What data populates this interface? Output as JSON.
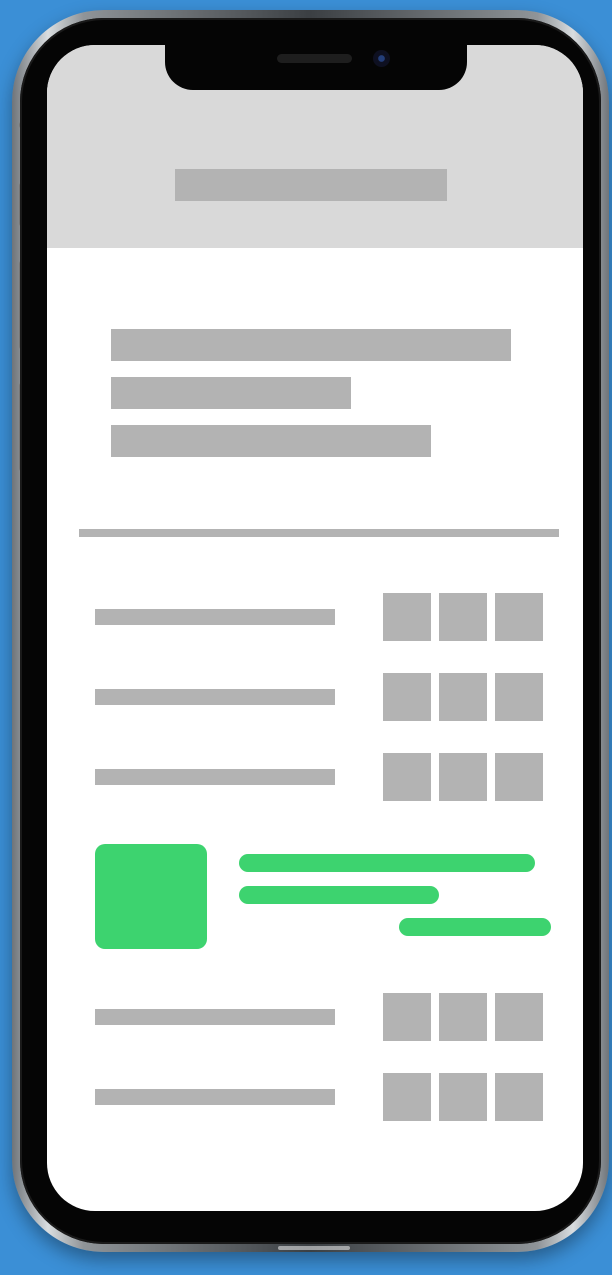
{
  "colors": {
    "background": "#3b8fd6",
    "header": "#d9d9d9",
    "placeholder": "#b3b3b3",
    "accent": "#3dd36f",
    "screen": "#ffffff",
    "bezel": "#050505"
  },
  "icons": {
    "front_camera": "camera-icon",
    "speaker": "speaker-icon"
  }
}
